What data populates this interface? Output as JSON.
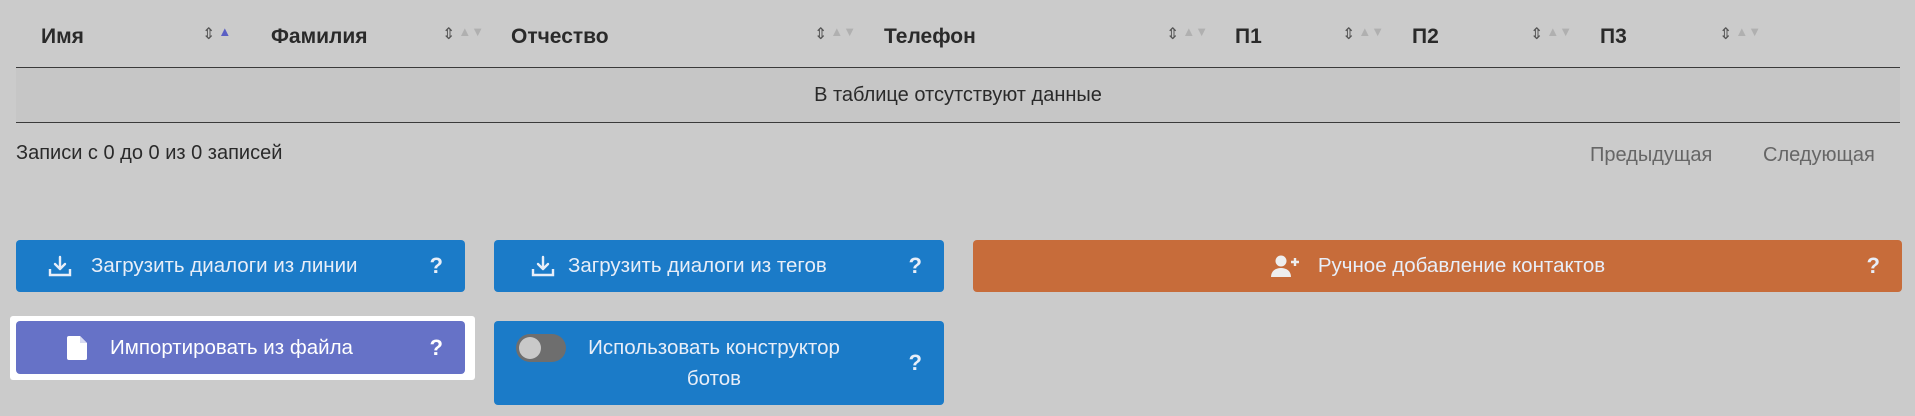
{
  "table": {
    "columns": [
      {
        "label": "Имя",
        "sort_active": true
      },
      {
        "label": "Фамилия",
        "sort_active": false
      },
      {
        "label": "Отчество",
        "sort_active": false
      },
      {
        "label": "Телефон",
        "sort_active": false
      },
      {
        "label": "П1",
        "sort_active": false
      },
      {
        "label": "П2",
        "sort_active": false
      },
      {
        "label": "П3",
        "sort_active": false
      }
    ],
    "empty_message": "В таблице отсутствуют данные"
  },
  "info": "Записи с 0 до 0 из 0 записей",
  "pagination": {
    "previous": "Предыдущая",
    "next": "Следующая"
  },
  "buttons": {
    "load_from_line": {
      "label": "Загрузить диалоги из линии",
      "help": "?",
      "icon": "download-icon"
    },
    "load_from_tags": {
      "label": "Загрузить диалоги из тегов",
      "help": "?",
      "icon": "download-icon"
    },
    "manual_add": {
      "label": "Ручное добавление контактов",
      "help": "?",
      "icon": "user-plus-icon"
    },
    "import_file": {
      "label": "Импортировать из файла",
      "help": "?",
      "icon": "file-icon"
    },
    "use_constructor": {
      "label_line1": "Использовать конструктор",
      "label_line2": "ботов",
      "help": "?",
      "enabled": false
    }
  },
  "colors": {
    "blue": "#1b7bc8",
    "orange": "#c76c3a",
    "purple": "#6672c7",
    "background": "#cbcbcb",
    "sort_active": "#5a5fc4"
  }
}
